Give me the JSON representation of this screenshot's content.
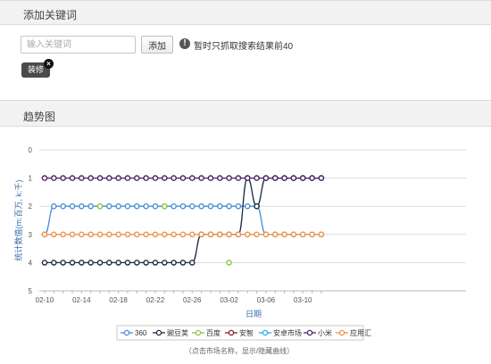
{
  "keyword_panel": {
    "title": "添加关键词",
    "input_value": "",
    "input_placeholder": "输入关键词",
    "add_button": "添加",
    "notice": "暂时只抓取搜索结果前40",
    "tags": [
      {
        "label": "装修"
      }
    ]
  },
  "trend_panel": {
    "title": "趋势图",
    "legend_hint": "（点击市场名称，显示/隐藏曲线）"
  },
  "colors": {
    "360": "#4a8fd6",
    "豌豆荚": "#1b2b44",
    "百度": "#8dc63f",
    "安智": "#8b1a1a",
    "安卓市场": "#29aae1",
    "小米": "#4b2567",
    "应用汇": "#e8964a"
  },
  "chart_data": {
    "type": "line",
    "title": "",
    "xlabel": "日期",
    "ylabel": "统计数值(m:百万, k:千)",
    "ylim": [
      5,
      0
    ],
    "yticks": [
      0,
      1,
      2,
      3,
      4,
      5
    ],
    "x_tick_labels": [
      "02-10",
      "02-14",
      "02-18",
      "02-22",
      "02-26",
      "03-02",
      "03-06",
      "03-10"
    ],
    "x": [
      "02-10",
      "02-11",
      "02-12",
      "02-13",
      "02-14",
      "02-15",
      "02-16",
      "02-17",
      "02-18",
      "02-19",
      "02-20",
      "02-21",
      "02-22",
      "02-23",
      "02-24",
      "02-25",
      "02-26",
      "02-27",
      "02-28",
      "03-01",
      "03-02",
      "03-03",
      "03-04",
      "03-05",
      "03-06",
      "03-07",
      "03-08",
      "03-09",
      "03-10",
      "03-11",
      "03-12"
    ],
    "legend_position": "bottom-center",
    "grid": true,
    "series": [
      {
        "name": "360",
        "values": [
          3,
          2,
          2,
          2,
          2,
          2,
          2,
          2,
          2,
          2,
          2,
          2,
          2,
          2,
          2,
          2,
          2,
          2,
          2,
          2,
          2,
          2,
          2,
          2,
          3,
          3,
          3,
          3,
          3,
          3,
          3
        ]
      },
      {
        "name": "豌豆荚",
        "values": [
          4,
          4,
          4,
          4,
          4,
          4,
          4,
          4,
          4,
          4,
          4,
          4,
          4,
          4,
          4,
          4,
          4,
          3,
          3,
          3,
          3,
          3,
          1,
          2,
          1,
          1,
          1,
          1,
          1,
          1,
          1
        ]
      },
      {
        "name": "百度",
        "values": [
          null,
          null,
          null,
          null,
          null,
          null,
          2,
          null,
          null,
          null,
          null,
          null,
          null,
          2,
          null,
          null,
          null,
          null,
          null,
          null,
          4,
          null,
          null,
          null,
          null,
          null,
          null,
          null,
          null,
          null,
          null
        ]
      },
      {
        "name": "安智",
        "values": []
      },
      {
        "name": "安卓市场",
        "values": []
      },
      {
        "name": "小米",
        "values": [
          1,
          1,
          1,
          1,
          1,
          1,
          1,
          1,
          1,
          1,
          1,
          1,
          1,
          1,
          1,
          1,
          1,
          1,
          1,
          1,
          1,
          1,
          1,
          1,
          1,
          1,
          1,
          1,
          1,
          1,
          1
        ]
      },
      {
        "name": "应用汇",
        "values": [
          3,
          3,
          3,
          3,
          3,
          3,
          3,
          3,
          3,
          3,
          3,
          3,
          3,
          3,
          3,
          3,
          3,
          3,
          3,
          3,
          3,
          3,
          3,
          3,
          3,
          3,
          3,
          3,
          3,
          3,
          3
        ]
      }
    ]
  }
}
